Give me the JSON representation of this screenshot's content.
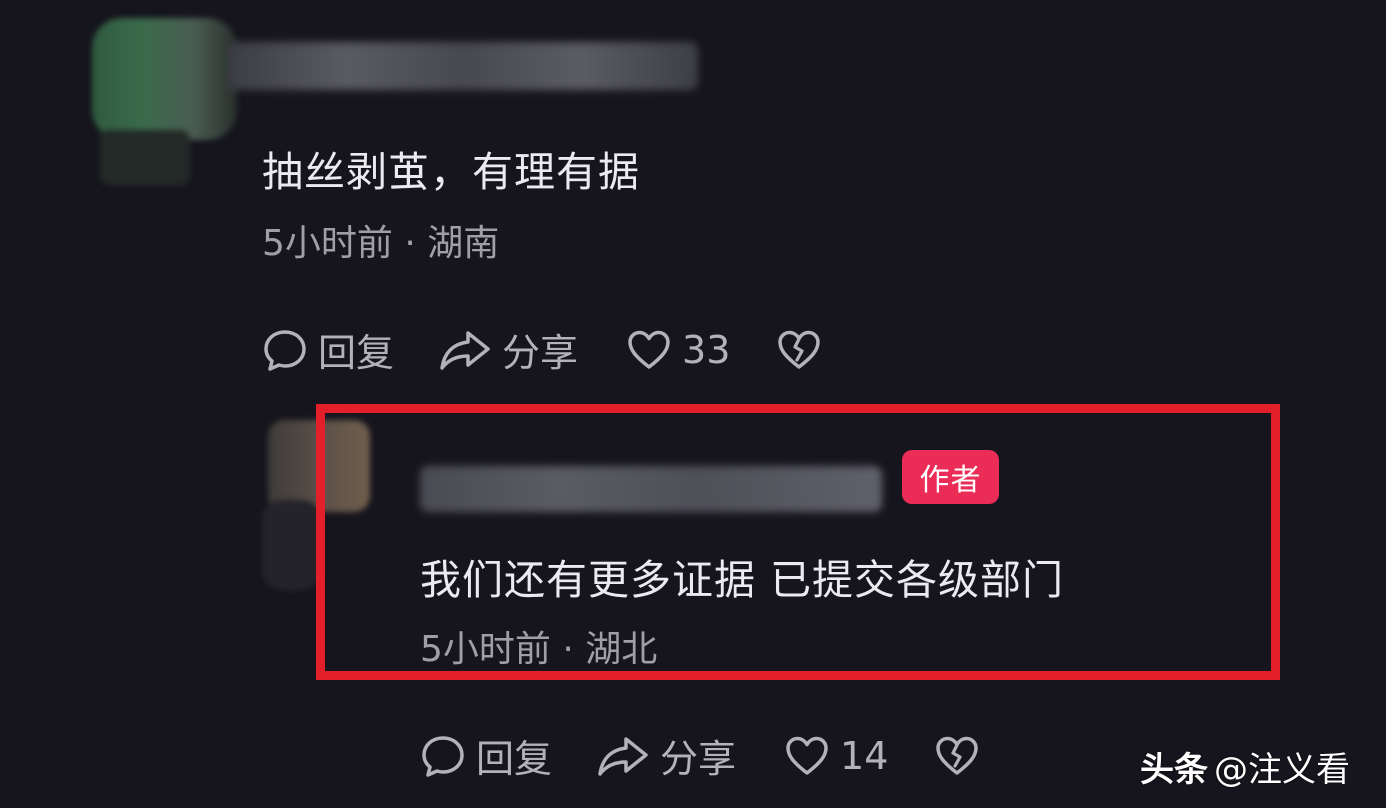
{
  "colors": {
    "background": "#16151d",
    "highlight_border": "#e3202a",
    "author_badge": "#ea2c56"
  },
  "comment1": {
    "text": "抽丝剥茧，有理有据",
    "meta": "5小时前 · 湖南",
    "actions": {
      "reply_icon": "comment-bubble-icon",
      "reply_label": "回复",
      "share_icon": "share-arrow-icon",
      "share_label": "分享",
      "like_icon": "heart-icon",
      "like_count": "33",
      "dislike_icon": "broken-heart-icon"
    }
  },
  "comment2": {
    "author_badge": "作者",
    "text": "我们还有更多证据 已提交各级部门",
    "meta": "5小时前 · 湖北",
    "actions": {
      "reply_icon": "comment-bubble-icon",
      "reply_label": "回复",
      "share_icon": "share-arrow-icon",
      "share_label": "分享",
      "like_icon": "heart-icon",
      "like_count": "14",
      "dislike_icon": "broken-heart-icon"
    }
  },
  "watermark": {
    "brand": "头条",
    "handle": "@注义看"
  }
}
